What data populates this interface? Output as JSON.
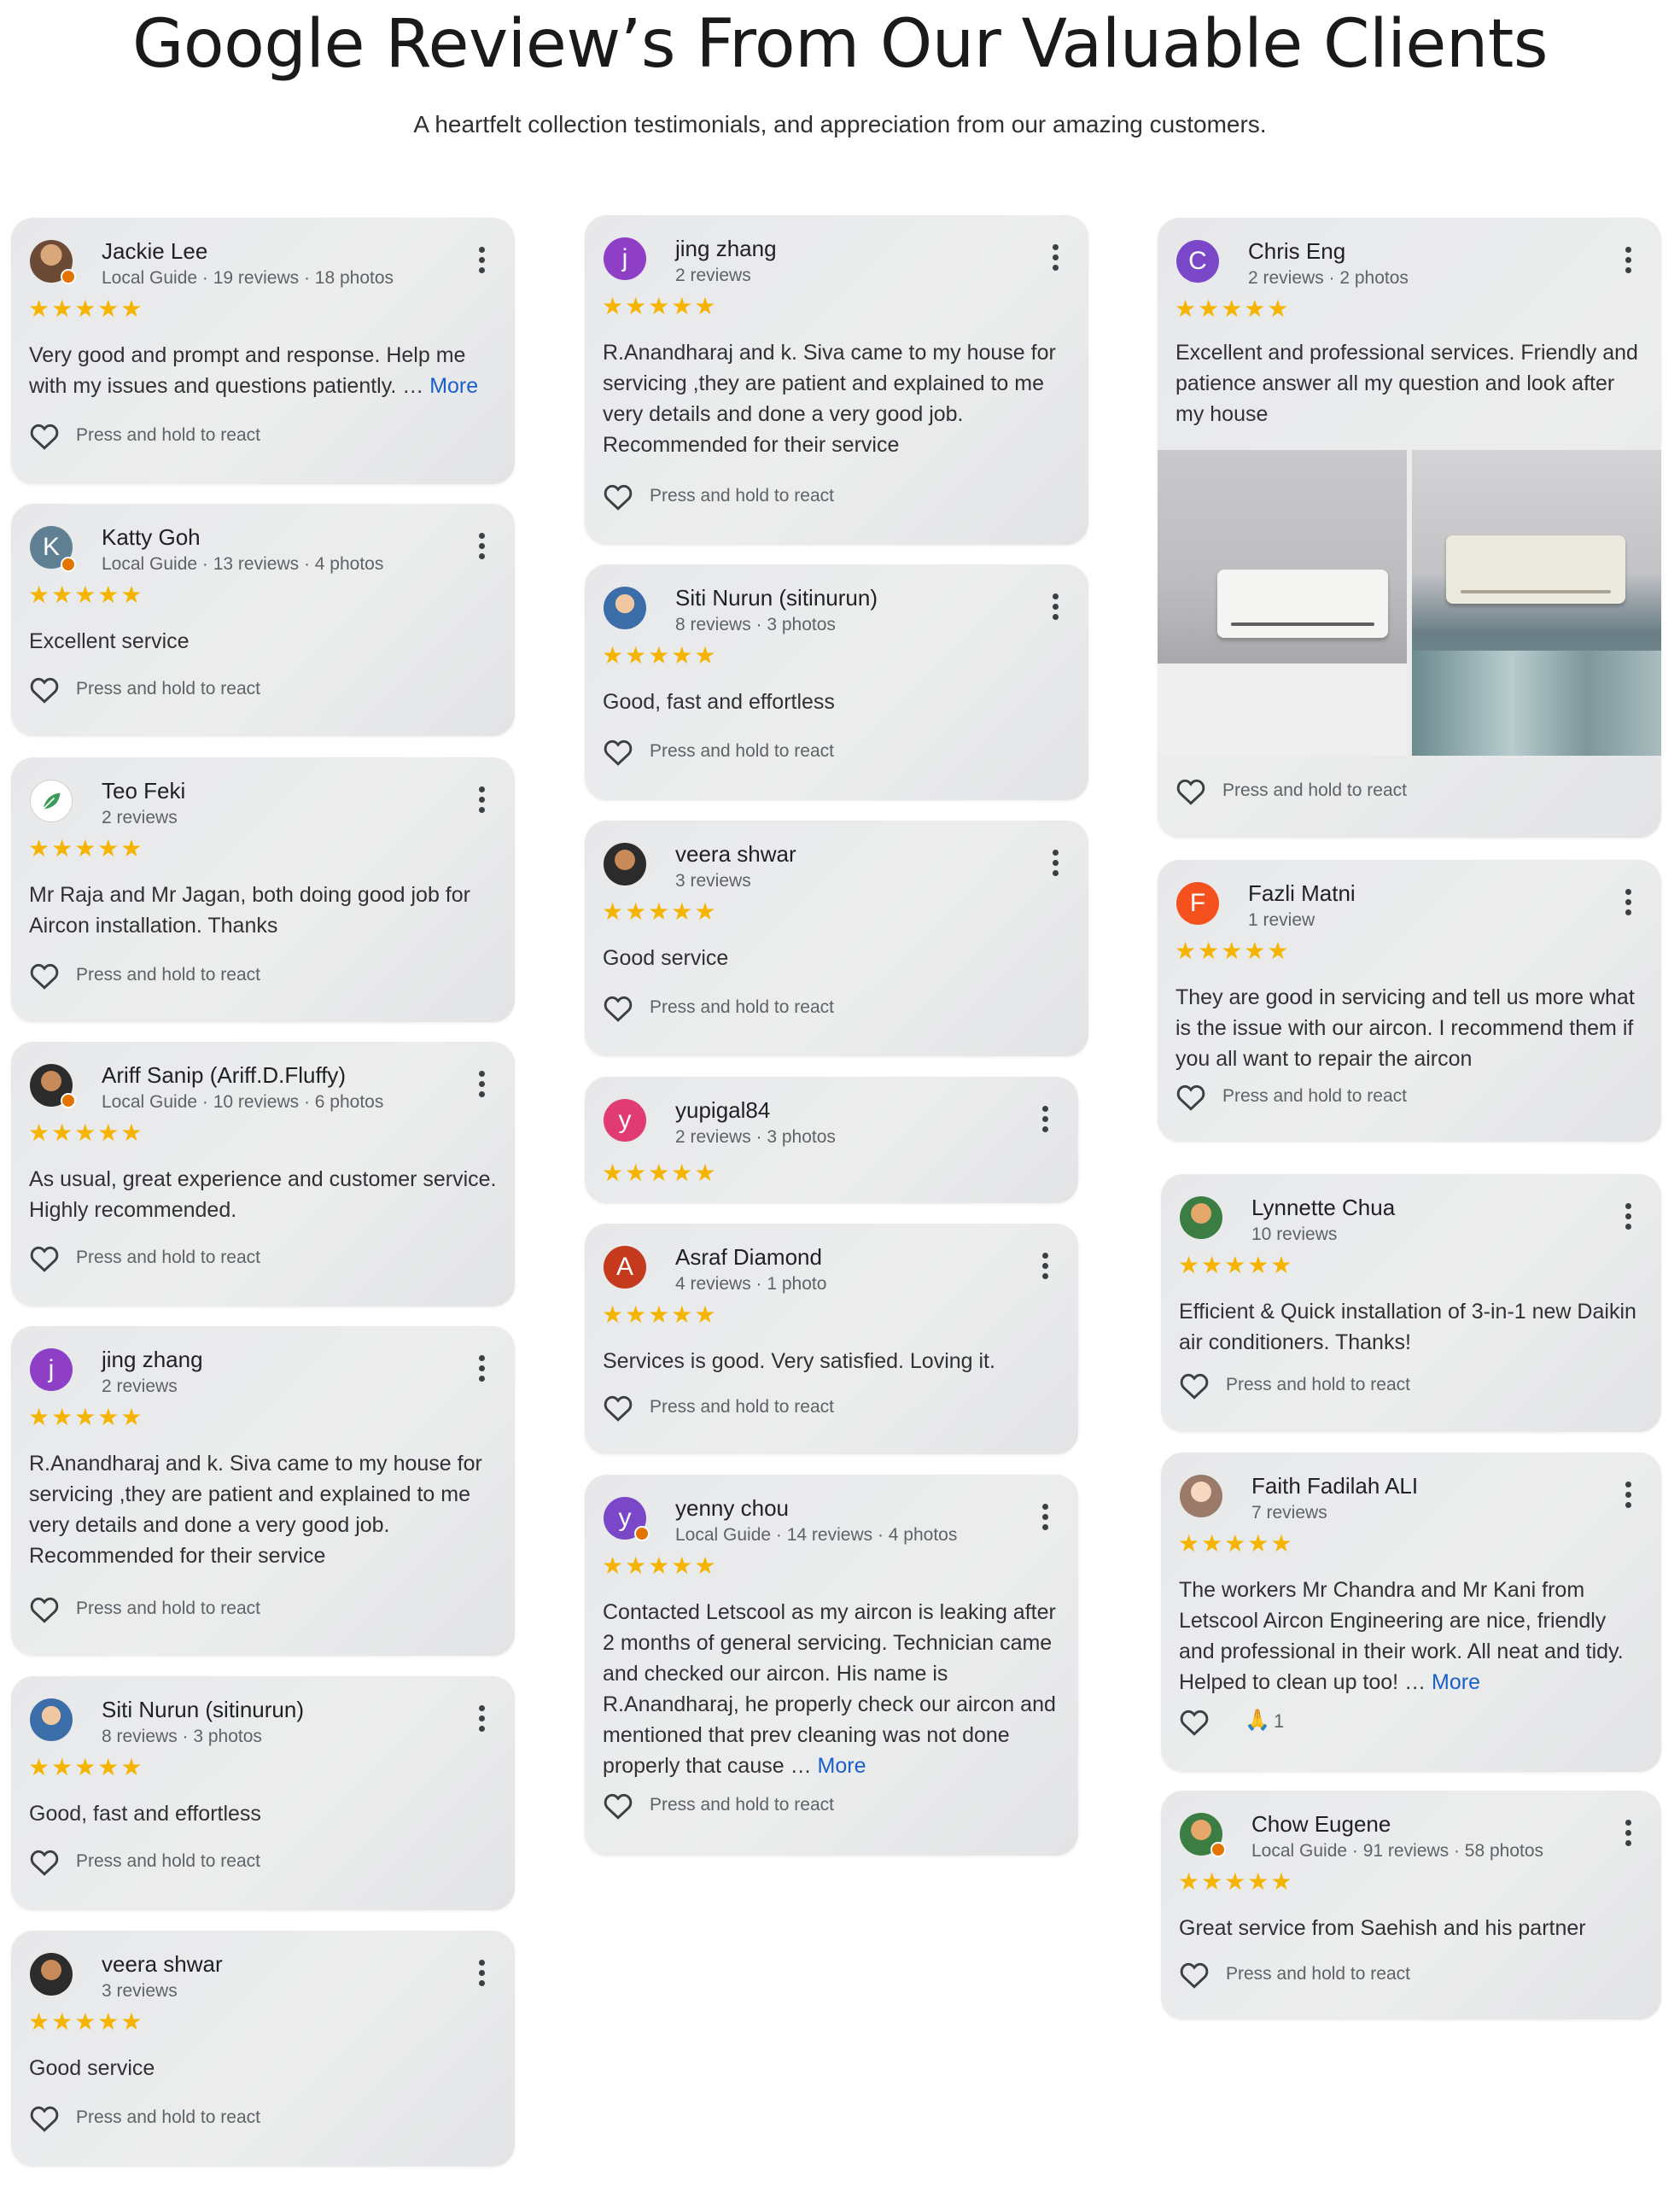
{
  "header": {
    "title": "Google Review’s From Our Valuable Clients",
    "subtitle": "A heartfelt collection testimonials, and appreciation from our amazing customers."
  },
  "react_label": "Press and hold to react",
  "stars": "★★★★★",
  "colors": {
    "star": "#f4b400",
    "link": "#1a5fc9",
    "card_bg": "#e9eaeb",
    "avatar_purple": "#8e3fc6",
    "avatar_violet": "#7a47c9",
    "avatar_steel": "#5f7f93",
    "avatar_pink": "#e13b74",
    "avatar_red": "#c5391c",
    "avatar_orange": "#f4511e",
    "guide_badge": "#e37400"
  },
  "reviews": [
    {
      "name": "Jackie Lee",
      "meta": "Local Guide · 19 reviews · 18 photos",
      "text": "Very good and prompt and response. Help me with my issues and questions patiently. … ",
      "more": "More",
      "avatar": "photo"
    },
    {
      "name": "Katty Goh",
      "meta": "Local Guide · 13 reviews · 4 photos",
      "text": "Excellent service",
      "avatar": "K"
    },
    {
      "name": "Teo Feki",
      "meta": "2 reviews",
      "text": "Mr Raja and Mr Jagan, both doing good job for Aircon installation. Thanks",
      "avatar": "leaf-logo"
    },
    {
      "name": "Ariff Sanip (Ariff.D.Fluffy)",
      "meta": "Local Guide · 10 reviews · 6 photos",
      "text": "As usual, great experience and customer service. Highly recommended.",
      "avatar": "photo"
    },
    {
      "name": "jing zhang",
      "meta": "2 reviews",
      "text": "R.Anandharaj and k. Siva came to my house for servicing ,they are patient and explained to me very details and done a very good job. Recommended for their service",
      "avatar": "j"
    },
    {
      "name": "Siti Nurun (sitinurun)",
      "meta": "8 reviews · 3 photos",
      "text": "Good, fast and effortless",
      "avatar": "photo"
    },
    {
      "name": "veera shwar",
      "meta": "3 reviews",
      "text": "Good service",
      "avatar": "photo"
    },
    {
      "name": "jing zhang",
      "meta": "2 reviews",
      "text": "R.Anandharaj and k. Siva came to my house for servicing ,they are patient and explained to me very details and done a very good job. Recommended for their service",
      "avatar": "j"
    },
    {
      "name": "Siti Nurun (sitinurun)",
      "meta": "8 reviews · 3 photos",
      "text": "Good, fast and effortless",
      "avatar": "photo"
    },
    {
      "name": "veera shwar",
      "meta": "3 reviews",
      "text": "Good service",
      "avatar": "photo"
    },
    {
      "name": "yupigal84",
      "meta": "2 reviews · 3 photos",
      "text": "",
      "avatar": "y"
    },
    {
      "name": "Asraf Diamond",
      "meta": "4 reviews · 1 photo",
      "text": "Services is good. Very satisfied. Loving it.",
      "avatar": "A"
    },
    {
      "name": "yenny chou",
      "meta": "Local Guide · 14 reviews · 4 photos",
      "text": "Contacted Letscool as my aircon is leaking after 2 months of general servicing. Technician came and checked our aircon. His name is R.Anandharaj, he properly check our aircon and mentioned that prev cleaning was not done properly that cause … ",
      "more": "More",
      "avatar": "y"
    },
    {
      "name": "Chris Eng",
      "meta": "2 reviews · 2 photos",
      "text": "Excellent and professional services. Friendly and patience answer all my question and look after my house",
      "avatar": "C"
    },
    {
      "name": "Fazli Matni",
      "meta": "1 review",
      "text": "They are good in servicing and tell us more what is the issue with our aircon. I recommend them if you all want to repair the aircon",
      "avatar": "F"
    },
    {
      "name": "Lynnette Chua",
      "meta": "10 reviews",
      "text": "Efficient & Quick installation of 3-in-1 new Daikin air conditioners. Thanks!",
      "avatar": "photo"
    },
    {
      "name": "Faith Fadilah ALI",
      "meta": "7 reviews",
      "text": "The workers Mr Chandra and Mr Kani from Letscool Aircon Engineering are nice, friendly and professional in their work. All neat and tidy. Helped to clean up too! … ",
      "more": "More",
      "avatar": "photo",
      "reaction": {
        "emoji": "🙏",
        "count": "1"
      }
    },
    {
      "name": "Chow Eugene",
      "meta": "Local Guide · 91 reviews · 58 photos",
      "text": "Great service from Saehish and his partner",
      "avatar": "photo"
    }
  ]
}
